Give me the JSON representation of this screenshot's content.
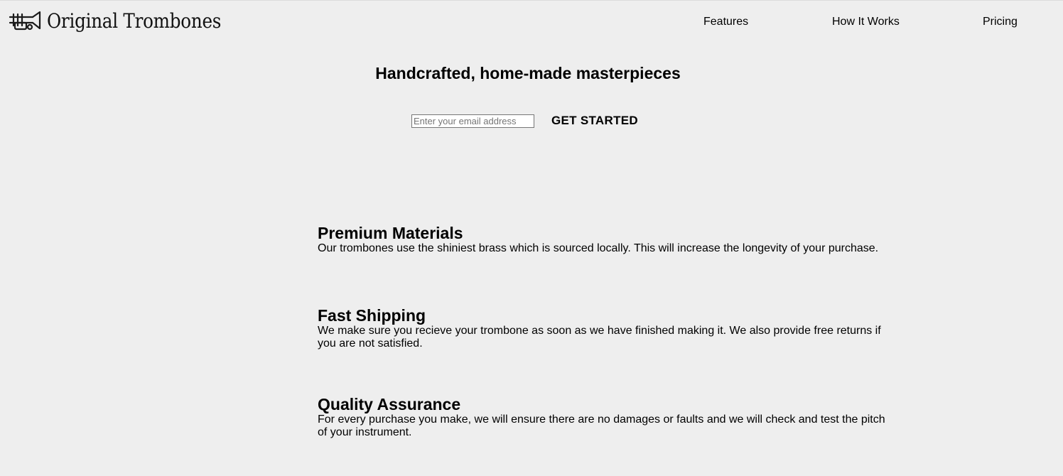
{
  "header": {
    "logo_text": "Original Trombones",
    "logo_icon": "trombone-icon",
    "nav": [
      {
        "label": "Features"
      },
      {
        "label": "How It Works"
      },
      {
        "label": "Pricing"
      }
    ]
  },
  "hero": {
    "title": "Handcrafted, home-made masterpieces",
    "email_placeholder": "Enter your email address",
    "email_value": "",
    "cta_label": "GET STARTED"
  },
  "features": [
    {
      "title": "Premium Materials",
      "text": "Our trombones use the shiniest brass which is sourced locally. This will increase the longevity of your purchase."
    },
    {
      "title": "Fast Shipping",
      "text": "We make sure you recieve your trombone as soon as we have finished making it. We also provide free returns if you are not satisfied."
    },
    {
      "title": "Quality Assurance",
      "text": "For every purchase you make, we will ensure there are no damages or faults and we will check and test the pitch of your instrument."
    }
  ],
  "colors": {
    "background": "#eeeeee",
    "text": "#000000"
  }
}
